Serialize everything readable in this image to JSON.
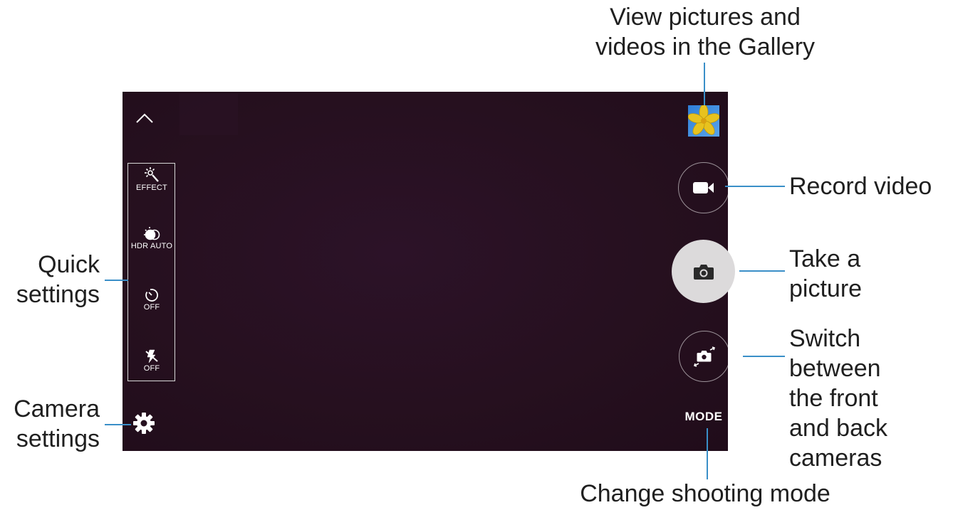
{
  "callouts": {
    "gallery": "View pictures and\nvideos in the Gallery",
    "record_video": "Record video",
    "take_picture": "Take a\npicture",
    "switch_cameras": "Switch\nbetween\nthe front\nand back\ncameras",
    "shooting_mode": "Change shooting mode",
    "quick_settings": "Quick\nsettings",
    "camera_settings": "Camera\nsettings"
  },
  "quick_settings": {
    "effect_label": "EFFECT",
    "hdr_label": "HDR AUTO",
    "timer_label": "OFF",
    "flash_label": "OFF"
  },
  "controls": {
    "mode_label": "MODE"
  },
  "colors": {
    "viewfinder": "#26101f",
    "callout_line": "#3a8fc8",
    "shutter": "#dcdadb"
  }
}
